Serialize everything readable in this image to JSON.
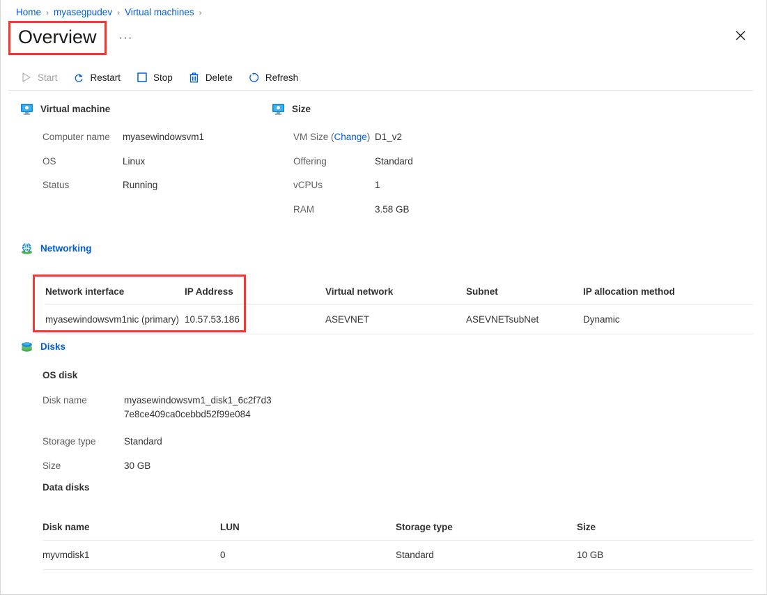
{
  "breadcrumb": {
    "items": [
      "Home",
      "myasegpudev",
      "Virtual machines"
    ],
    "separator": "›"
  },
  "header": {
    "title": "Overview",
    "more_label": "···",
    "close_icon": "close-icon"
  },
  "toolbar": {
    "commands": [
      {
        "label": "Start",
        "icon": "play-icon",
        "disabled": true
      },
      {
        "label": "Restart",
        "icon": "restart-icon",
        "disabled": false
      },
      {
        "label": "Stop",
        "icon": "stop-icon",
        "disabled": false
      },
      {
        "label": "Delete",
        "icon": "trash-icon",
        "disabled": false
      },
      {
        "label": "Refresh",
        "icon": "refresh-icon",
        "disabled": false
      }
    ]
  },
  "virtual_machine": {
    "heading": "Virtual machine",
    "icon": "monitor-icon",
    "rows": [
      {
        "label": "Computer name",
        "value": "myasewindowsvm1"
      },
      {
        "label": "OS",
        "value": "Linux"
      },
      {
        "label": "Status",
        "value": "Running"
      }
    ]
  },
  "size": {
    "heading": "Size",
    "icon": "monitor-icon",
    "vm_size_label": "VM Size (",
    "vm_size_link": "Change",
    "vm_size_label_end": ")",
    "rows": [
      {
        "label": "VM Size (Change)",
        "value": "D1_v2"
      },
      {
        "label": "Offering",
        "value": "Standard"
      },
      {
        "label": "vCPUs",
        "value": "1"
      },
      {
        "label": "RAM",
        "value": "3.58 GB"
      }
    ]
  },
  "networking": {
    "heading": "Networking",
    "icon": "globe-icon",
    "columns": [
      "Network interface",
      "IP Address",
      "Virtual network",
      "Subnet",
      "IP allocation method"
    ],
    "rows": [
      {
        "network_interface": "myasewindowsvm1nic (primary)",
        "ip_address": "10.57.53.186",
        "virtual_network": "ASEVNET",
        "subnet": "ASEVNETsubNet",
        "ip_allocation_method": "Dynamic"
      }
    ]
  },
  "disks": {
    "heading": "Disks",
    "icon": "disk-icon",
    "os_disk": {
      "heading": "OS disk",
      "rows": [
        {
          "label": "Disk name",
          "value": "myasewindowsvm1_disk1_6c2f7d3\n7e8ce409ca0cebbd52f99e084"
        },
        {
          "label": "Storage type",
          "value": "Standard"
        },
        {
          "label": "Size",
          "value": "30 GB"
        }
      ]
    },
    "data_disks": {
      "heading": "Data disks",
      "columns": [
        "Disk name",
        "LUN",
        "Storage type",
        "Size"
      ],
      "rows": [
        {
          "disk_name": "myvmdisk1",
          "lun": "0",
          "storage_type": "Standard",
          "size": "10 GB"
        }
      ]
    }
  },
  "annotations": {
    "highlight_color": "#f03a2f",
    "boxes": [
      "title-highlight",
      "network-interface-highlight"
    ]
  },
  "colors": {
    "link": "#015cda",
    "text": "#323130",
    "muted": "#605e5c",
    "disabled": "#a19f9d",
    "divider": "#edebe9",
    "highlight": "#f03a2f"
  }
}
